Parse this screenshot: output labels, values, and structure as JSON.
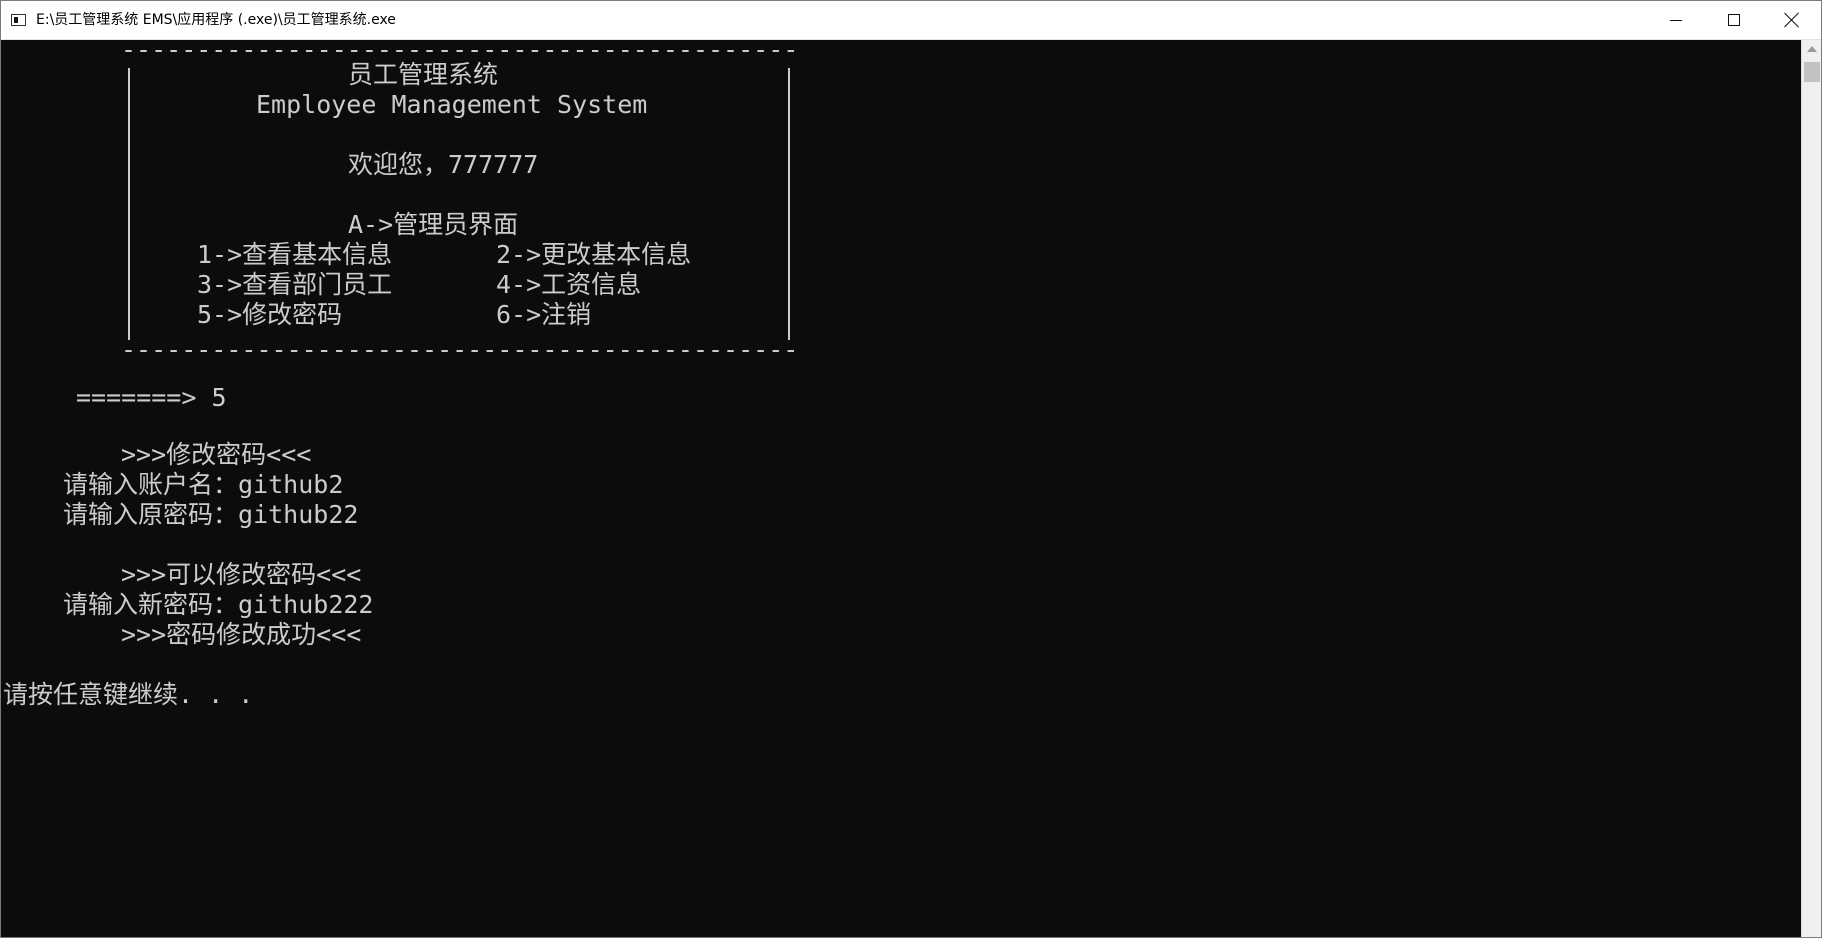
{
  "window": {
    "title": "E:\\员工管理系统 EMS\\应用程序 (.exe)\\员工管理系统.exe",
    "icon": "console-window-icon"
  },
  "console": {
    "border_top": "---------------------------------------------",
    "border_bottom": "---------------------------------------------",
    "title_cn": "员工管理系统",
    "title_en": "Employee Management System",
    "welcome": "欢迎您，777777",
    "admin_header": "A->管理员界面",
    "menu": {
      "opt1": "1->查看基本信息",
      "opt2": "2->更改基本信息",
      "opt3": "3->查看部门员工",
      "opt4": "4->工资信息",
      "opt5": "5->修改密码",
      "opt6": "6->注销"
    },
    "prompt_symbol": "=======>",
    "choice": "5",
    "section_header": ">>>修改密码<<<",
    "account_label": "请输入账户名：",
    "account_value": "github2",
    "old_pwd_label": "请输入原密码：",
    "old_pwd_value": "github22",
    "can_change": ">>>可以修改密码<<<",
    "new_pwd_label": "请输入新密码：",
    "new_pwd_value": "github222",
    "success": ">>>密码修改成功<<<",
    "continue": "请按任意键继续. . ."
  },
  "colors": {
    "console_bg": "#0c0c0c",
    "console_text": "#cccccc",
    "titlebar_bg": "#ffffff"
  }
}
